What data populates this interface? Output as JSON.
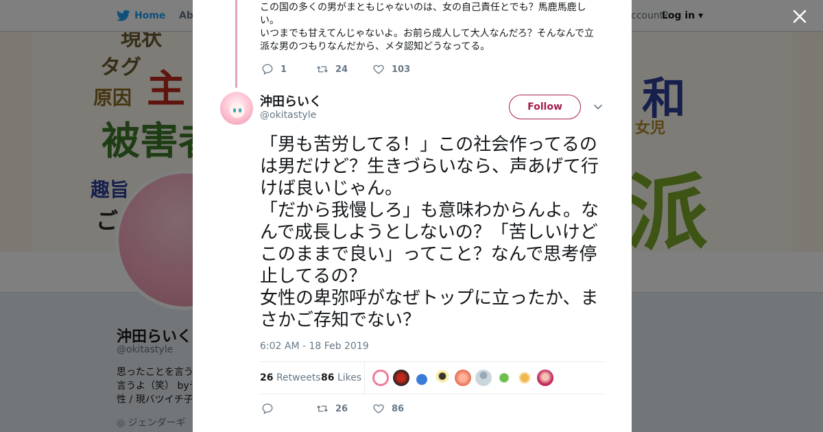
{
  "background_page": {
    "nav": {
      "home_label": "Home",
      "about_label": "Abo",
      "account_prompt": "ccount?",
      "login_label": "Log in"
    },
    "banner_words": [
      "現状",
      "タグ",
      "主",
      "原因",
      "被害者",
      "趣旨",
      "ご",
      "和",
      "女児",
      "派"
    ],
    "profile": {
      "name": "沖田らいく",
      "handle": "@okitastyle",
      "bio_lines": [
        "思ったことを言う",
        "言うよ（笑） byテ",
        "性 / 現バツイチ子"
      ],
      "location": "ジェンダーギ"
    }
  },
  "previous_tweet": {
    "text": "この国の多くの男がまともじゃないのは、女の自己責任とでも？馬鹿馬鹿しい。\nいつまでも甘えてんじゃないよ。お前ら成人して大人なんだろ？そんなんで立派な男のつもりなんだから、メタ認知どうなってる。",
    "replies": "1",
    "retweets": "24",
    "likes": "103"
  },
  "tweet": {
    "author_name": "沖田らいく",
    "author_handle": "@okitastyle",
    "follow_label": "Follow",
    "text": "「男も苦労してる！」この社会作ってるのは男だけど？生きづらいなら、声あげて行けば良いじゃん。\n「だから我慢しろ」も意味わからんよ。なんで成長しようとしないの？「苦しいけどこのままで良い」ってこと？なんで思考停止してるの？\n女性の卑弥呼がなぜトップに立ったか、まさかご存知でない？",
    "timestamp": "6:02 AM - 18 Feb 2019",
    "retweet_count": "26",
    "retweet_label": "Retweets",
    "like_count": "86",
    "like_label": "Likes",
    "action_retweets": "26",
    "action_likes": "86"
  },
  "colors": {
    "accent": "#a31d4e",
    "twitter_blue": "#1da1f2",
    "thread_line": "#e2a4b5",
    "muted_text": "#657786"
  },
  "icons": [
    "twitter-bird-icon",
    "close-icon",
    "reply-icon",
    "retweet-icon",
    "like-icon",
    "chevron-down-icon"
  ]
}
